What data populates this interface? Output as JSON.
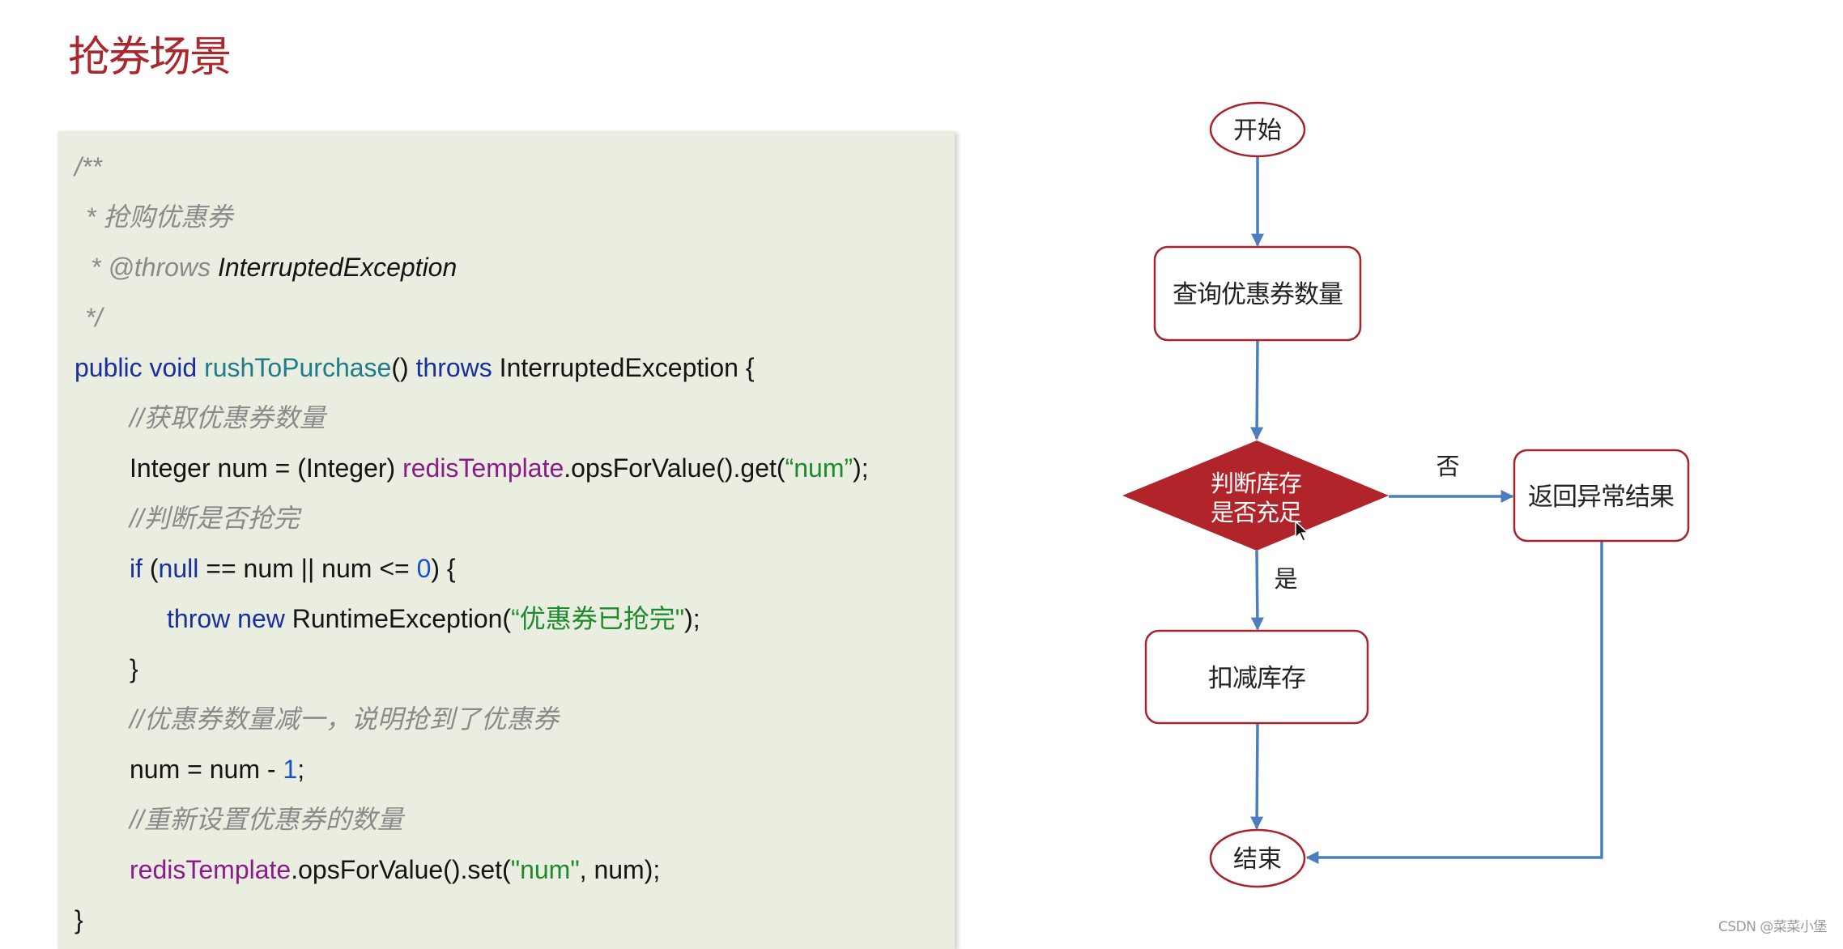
{
  "slide": {
    "title": "抢券场景"
  },
  "code": {
    "lines": [
      {
        "indent": 0,
        "offset": 0,
        "tokens": [
          {
            "t": "comment",
            "v": "/**"
          }
        ]
      },
      {
        "indent": 0,
        "offset": 14,
        "tokens": [
          {
            "t": "comment",
            "v": "* 抢购优惠券"
          }
        ]
      },
      {
        "indent": 0,
        "offset": 20,
        "tokens": [
          {
            "t": "comment",
            "v": "* @throws "
          },
          {
            "t": "doc-type",
            "v": "InterruptedException"
          }
        ]
      },
      {
        "indent": 0,
        "offset": 13,
        "tokens": [
          {
            "t": "comment",
            "v": "*/"
          }
        ]
      },
      {
        "indent": 0,
        "offset": 0,
        "tokens": [
          {
            "t": "kw",
            "v": "public void "
          },
          {
            "t": "method",
            "v": "rushToPurchase"
          },
          {
            "t": "plain",
            "v": "() "
          },
          {
            "t": "kw",
            "v": "throws"
          },
          {
            "t": "plain",
            "v": " InterruptedException {"
          }
        ]
      },
      {
        "indent": 1,
        "offset": 0,
        "tokens": [
          {
            "t": "comment",
            "v": "//获取优惠券数量"
          }
        ]
      },
      {
        "indent": 1,
        "offset": 0,
        "tokens": [
          {
            "t": "plain",
            "v": "Integer num = (Integer) "
          },
          {
            "t": "field",
            "v": "redisTemplate"
          },
          {
            "t": "plain",
            "v": ".opsForValue().get("
          },
          {
            "t": "string",
            "v": "“num”"
          },
          {
            "t": "plain",
            "v": ");"
          }
        ]
      },
      {
        "indent": 1,
        "offset": 0,
        "tokens": [
          {
            "t": "comment",
            "v": "//判断是否抢完"
          }
        ]
      },
      {
        "indent": 1,
        "offset": 0,
        "tokens": [
          {
            "t": "kw",
            "v": "if"
          },
          {
            "t": "plain",
            "v": " ("
          },
          {
            "t": "kw",
            "v": "null"
          },
          {
            "t": "plain",
            "v": " == num || num <= "
          },
          {
            "t": "number",
            "v": "0"
          },
          {
            "t": "plain",
            "v": ") {"
          }
        ]
      },
      {
        "indent": 2,
        "offset": 0,
        "tokens": [
          {
            "t": "kw",
            "v": "throw new"
          },
          {
            "t": "plain",
            "v": " RuntimeException("
          },
          {
            "t": "string",
            "v": "“优惠券已抢完\""
          },
          {
            "t": "plain",
            "v": ");"
          }
        ]
      },
      {
        "indent": 1,
        "offset": 0,
        "tokens": [
          {
            "t": "plain",
            "v": "}"
          }
        ]
      },
      {
        "indent": 1,
        "offset": 0,
        "tokens": [
          {
            "t": "comment",
            "v": "//优惠券数量减一，说明抢到了优惠券"
          }
        ]
      },
      {
        "indent": 1,
        "offset": 0,
        "tokens": [
          {
            "t": "plain",
            "v": "num = num - "
          },
          {
            "t": "number",
            "v": "1"
          },
          {
            "t": "plain",
            "v": ";"
          }
        ]
      },
      {
        "indent": 1,
        "offset": 0,
        "tokens": [
          {
            "t": "comment",
            "v": "//重新设置优惠券的数量"
          }
        ]
      },
      {
        "indent": 1,
        "offset": 0,
        "tokens": [
          {
            "t": "field",
            "v": "redisTemplate"
          },
          {
            "t": "plain",
            "v": ".opsForValue().set("
          },
          {
            "t": "string",
            "v": "\"num\""
          },
          {
            "t": "plain",
            "v": ", num);"
          }
        ]
      },
      {
        "indent": 0,
        "offset": 0,
        "tokens": [
          {
            "t": "plain",
            "v": "}"
          }
        ]
      }
    ]
  },
  "flowchart": {
    "start": "开始",
    "query": "查询优惠券数量",
    "decision": [
      "判断库存",
      "是否充足"
    ],
    "deduct": "扣减库存",
    "error": "返回异常结果",
    "end": "结束",
    "yes_label": "是",
    "no_label": "否",
    "colors": {
      "node_border": "#a8242b",
      "decision_fill": "#b0242a",
      "arrow": "#4a7ebf",
      "text": "#222222"
    }
  },
  "watermark": "CSDN @菜菜小堡"
}
